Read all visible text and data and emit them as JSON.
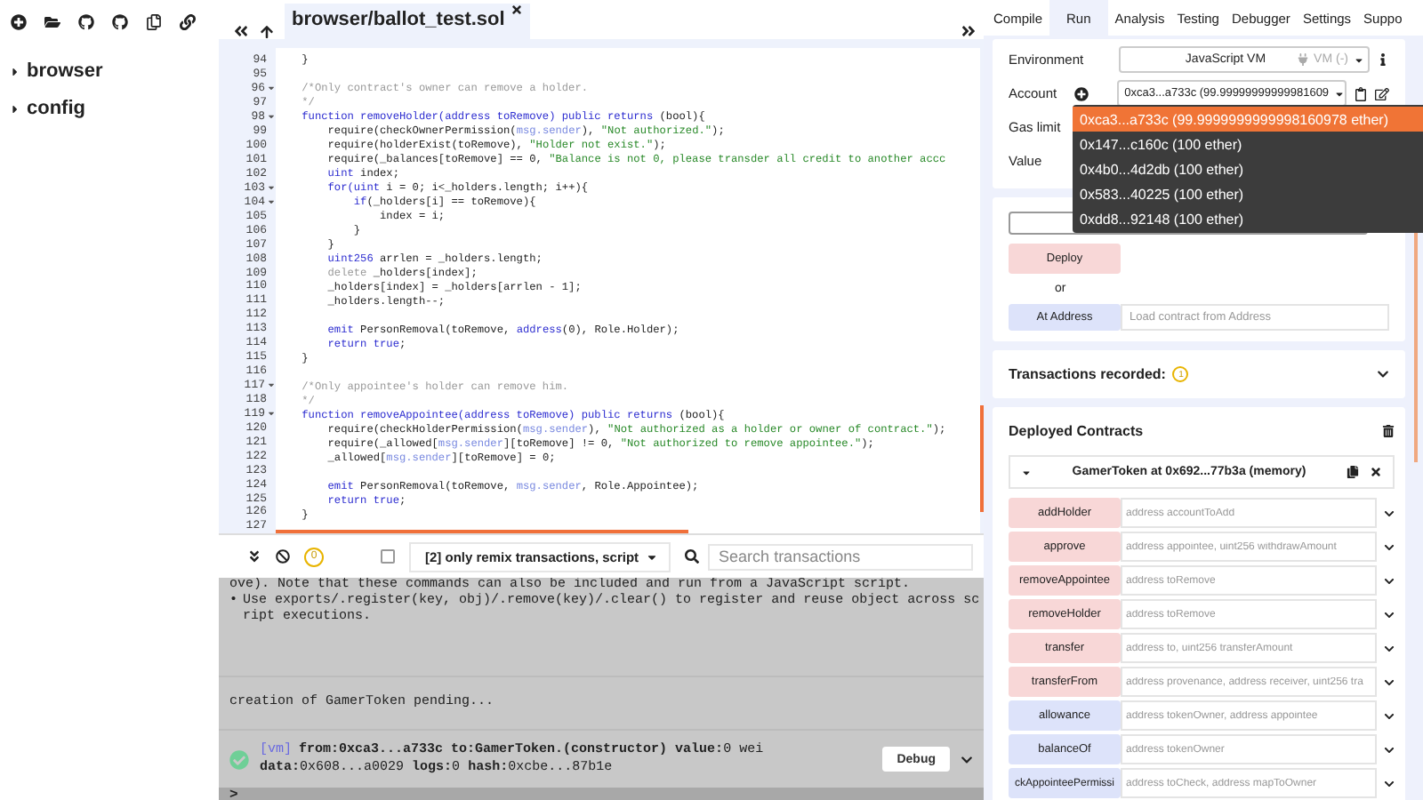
{
  "sidebar": {
    "tree": [
      {
        "label": "browser",
        "expanded": false
      },
      {
        "label": "config",
        "expanded": false
      }
    ]
  },
  "editor": {
    "tabs": [
      {
        "label": "browser/ballot_test.sol",
        "selected": true
      }
    ],
    "lines": [
      {
        "n": "94",
        "foldable": false,
        "code": [
          {
            "kind": "plain",
            "text": "    }"
          }
        ]
      },
      {
        "n": "95",
        "foldable": false
      },
      {
        "n": "96",
        "foldable": true,
        "code": [
          {
            "kind": "comment",
            "text": "    /*Only contract's owner can remove a holder."
          }
        ]
      },
      {
        "n": "97",
        "foldable": false,
        "code": [
          {
            "kind": "comment",
            "text": "    */"
          }
        ]
      },
      {
        "n": "98",
        "foldable": true,
        "code": [
          {
            "kind": "keyword",
            "text": "    function removeHolder(address toRemove) public returns "
          },
          {
            "kind": "plain",
            "text": "(bool){"
          }
        ]
      },
      {
        "n": "99",
        "foldable": false,
        "code": [
          {
            "kind": "plain",
            "text": "        require(checkOwnerPermission("
          },
          {
            "kind": "builtin",
            "text": "msg.sender"
          },
          {
            "kind": "plain",
            "text": "), "
          },
          {
            "kind": "string",
            "text": "\"Not authorized.\""
          },
          {
            "kind": "plain",
            "text": ");"
          }
        ]
      },
      {
        "n": "100",
        "foldable": false,
        "code": [
          {
            "kind": "plain",
            "text": "        require(holderExist(toRemove), "
          },
          {
            "kind": "string",
            "text": "\"Holder not exist.\""
          },
          {
            "kind": "plain",
            "text": ");"
          }
        ]
      },
      {
        "n": "101",
        "foldable": false,
        "code": [
          {
            "kind": "plain",
            "text": "        require(_balances[toRemove] == 0, "
          },
          {
            "kind": "string",
            "text": "\"Balance is not 0, please transder all credit to another accc"
          }
        ]
      },
      {
        "n": "102",
        "foldable": false,
        "code": [
          {
            "kind": "keyword",
            "text": "        uint"
          },
          {
            "kind": "plain",
            "text": " index;"
          }
        ]
      },
      {
        "n": "103",
        "foldable": true,
        "code": [
          {
            "kind": "keyword",
            "text": "        for(uint"
          },
          {
            "kind": "plain",
            "text": " i = 0; i<_holders.length; i++){"
          }
        ]
      },
      {
        "n": "104",
        "foldable": true,
        "code": [
          {
            "kind": "keyword",
            "text": "            if"
          },
          {
            "kind": "plain",
            "text": "(_holders[i] == toRemove){"
          }
        ]
      },
      {
        "n": "105",
        "foldable": false,
        "code": [
          {
            "kind": "plain",
            "text": "                index = i;"
          }
        ]
      },
      {
        "n": "106",
        "foldable": false,
        "code": [
          {
            "kind": "plain",
            "text": "            }"
          }
        ]
      },
      {
        "n": "107",
        "foldable": false,
        "code": [
          {
            "kind": "plain",
            "text": "        }"
          }
        ]
      },
      {
        "n": "108",
        "foldable": false,
        "code": [
          {
            "kind": "keyword",
            "text": "        uint256"
          },
          {
            "kind": "plain",
            "text": " arrlen = _holders.length;"
          }
        ]
      },
      {
        "n": "109",
        "foldable": false,
        "code": [
          {
            "kind": "comment",
            "text": "        delete"
          },
          {
            "kind": "plain",
            "text": " _holders[index];"
          }
        ]
      },
      {
        "n": "110",
        "foldable": false,
        "code": [
          {
            "kind": "plain",
            "text": "        _holders[index] = _holders[arrlen - 1];"
          }
        ]
      },
      {
        "n": "111",
        "foldable": false,
        "code": [
          {
            "kind": "plain",
            "text": "        _holders.length--;"
          }
        ]
      },
      {
        "n": "112",
        "foldable": false
      },
      {
        "n": "113",
        "foldable": false,
        "code": [
          {
            "kind": "keyword",
            "text": "        emit"
          },
          {
            "kind": "plain",
            "text": " PersonRemoval(toRemove, "
          },
          {
            "kind": "keyword",
            "text": "address"
          },
          {
            "kind": "plain",
            "text": "(0), Role.Holder);"
          }
        ]
      },
      {
        "n": "114",
        "foldable": false,
        "code": [
          {
            "kind": "keyword",
            "text": "        return true"
          },
          {
            "kind": "plain",
            "text": ";"
          }
        ]
      },
      {
        "n": "115",
        "foldable": false,
        "code": [
          {
            "kind": "plain",
            "text": "    }"
          }
        ]
      },
      {
        "n": "116",
        "foldable": false
      },
      {
        "n": "117",
        "foldable": true,
        "code": [
          {
            "kind": "comment",
            "text": "    /*Only appointee's holder can remove him."
          }
        ]
      },
      {
        "n": "118",
        "foldable": false,
        "code": [
          {
            "kind": "comment",
            "text": "    */"
          }
        ]
      },
      {
        "n": "119",
        "foldable": true,
        "code": [
          {
            "kind": "keyword",
            "text": "    function removeAppointee(address toRemove) public returns "
          },
          {
            "kind": "plain",
            "text": "(bool){"
          }
        ]
      },
      {
        "n": "120",
        "foldable": false,
        "code": [
          {
            "kind": "plain",
            "text": "        require(checkHolderPermission("
          },
          {
            "kind": "builtin",
            "text": "msg.sender"
          },
          {
            "kind": "plain",
            "text": "), "
          },
          {
            "kind": "string",
            "text": "\"Not authorized as a holder or owner of contract.\""
          },
          {
            "kind": "plain",
            "text": ");"
          }
        ]
      },
      {
        "n": "121",
        "foldable": false,
        "code": [
          {
            "kind": "plain",
            "text": "        require(_allowed["
          },
          {
            "kind": "builtin",
            "text": "msg.sender"
          },
          {
            "kind": "plain",
            "text": "][toRemove] != 0, "
          },
          {
            "kind": "string",
            "text": "\"Not authorized to remove appointee.\""
          },
          {
            "kind": "plain",
            "text": ");"
          }
        ]
      },
      {
        "n": "122",
        "foldable": false,
        "code": [
          {
            "kind": "plain",
            "text": "        _allowed["
          },
          {
            "kind": "builtin",
            "text": "msg.sender"
          },
          {
            "kind": "plain",
            "text": "][toRemove] = 0;"
          }
        ]
      },
      {
        "n": "123",
        "foldable": false
      },
      {
        "n": "124",
        "foldable": false,
        "code": [
          {
            "kind": "keyword",
            "text": "        emit"
          },
          {
            "kind": "plain",
            "text": " PersonRemoval(toRemove, "
          },
          {
            "kind": "builtin",
            "text": "msg.sender"
          },
          {
            "kind": "plain",
            "text": ", Role.Appointee);"
          }
        ]
      },
      {
        "n": "125",
        "foldable": false,
        "code": [
          {
            "kind": "keyword",
            "text": "        return true"
          },
          {
            "kind": "plain",
            "text": ";"
          }
        ]
      },
      {
        "n": "126",
        "foldable": false,
        "code": [
          {
            "kind": "plain",
            "text": "    }"
          }
        ]
      },
      {
        "n": "127",
        "foldable": false
      }
    ]
  },
  "terminal": {
    "pending_count": "0",
    "listen_checked": false,
    "filter": "[2] only remix transactions, script",
    "search_placeholder": "Search transactions",
    "log": [
      {
        "kind": "text",
        "text": "ove). Note that these commands can also be included and run from a JavaScript script."
      },
      {
        "kind": "bullet",
        "marker": "•",
        "text": "Use exports/.register(key, obj)/.remove(key)/.clear() to register and reuse object across script executions."
      },
      {
        "kind": "info",
        "text": "creation of GamerToken pending..."
      },
      {
        "kind": "tx",
        "tag": "[vm]",
        "text": "**from:0xca3...a733c to:GamerToken.(constructor) value:**0 wei **data:**0x608...a0029 **logs:**0 **hash:**0xcbe...87b1e",
        "button": "Debug"
      }
    ],
    "prompt": ">"
  },
  "run_panel": {
    "tabs": [
      {
        "label": "Compile",
        "selected": false
      },
      {
        "label": "Run",
        "selected": true
      },
      {
        "label": "Analysis",
        "selected": false
      },
      {
        "label": "Testing",
        "selected": false
      },
      {
        "label": "Debugger",
        "selected": false
      },
      {
        "label": "Settings",
        "selected": false
      },
      {
        "label": "Suppo",
        "selected": false
      }
    ],
    "environment": {
      "label": "Environment",
      "value": "JavaScript VM",
      "provider": "VM (-)"
    },
    "account": {
      "label": "Account",
      "value": "0xca3...a733c (99.99999999999981609",
      "options": [
        {
          "label": "0xca3...a733c (99.9999999999998160978 ether)",
          "selected": true
        },
        {
          "label": "0x147...c160c (100 ether)",
          "selected": false
        },
        {
          "label": "0x4b0...4d2db (100 ether)",
          "selected": false
        },
        {
          "label": "0x583...40225 (100 ether)",
          "selected": false
        },
        {
          "label": "0xdd8...92148 (100 ether)",
          "selected": false
        }
      ]
    },
    "gas_limit_label": "Gas limit",
    "value_label": "Value",
    "deploy": {
      "button": "Deploy",
      "or": "or",
      "at_address_button": "At Address",
      "at_address_placeholder": "Load contract from Address"
    },
    "transactions": {
      "title": "Transactions recorded:",
      "count": "1"
    },
    "deployed": {
      "title": "Deployed Contracts",
      "instance": {
        "title": "GamerToken at 0x692...77b3a (memory)",
        "expanded": true
      },
      "functions": [
        {
          "name": "addHolder",
          "placeholder": "address accountToAdd",
          "kind": "transact"
        },
        {
          "name": "approve",
          "placeholder": "address appointee, uint256 withdrawAmount",
          "kind": "transact"
        },
        {
          "name": "removeAppointee",
          "placeholder": "address toRemove",
          "kind": "transact"
        },
        {
          "name": "removeHolder",
          "placeholder": "address toRemove",
          "kind": "transact"
        },
        {
          "name": "transfer",
          "placeholder": "address to, uint256 transferAmount",
          "kind": "transact"
        },
        {
          "name": "transferFrom",
          "placeholder": "address provenance, address receiver, uint256 tra",
          "kind": "transact"
        },
        {
          "name": "allowance",
          "placeholder": "address tokenOwner, address appointee",
          "kind": "call"
        },
        {
          "name": "balanceOf",
          "placeholder": "address tokenOwner",
          "kind": "call"
        },
        {
          "name": "ckAppointeePermissi",
          "placeholder": "address toCheck, address mapToOwner",
          "kind": "call"
        }
      ]
    }
  }
}
